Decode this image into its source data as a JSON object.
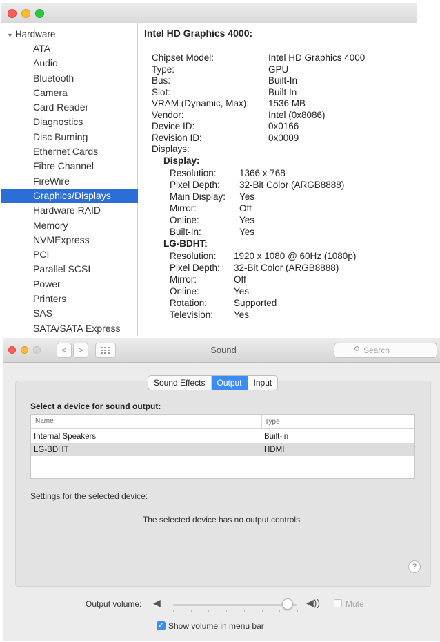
{
  "sysinfo": {
    "group": "Hardware",
    "items": [
      "ATA",
      "Audio",
      "Bluetooth",
      "Camera",
      "Card Reader",
      "Diagnostics",
      "Disc Burning",
      "Ethernet Cards",
      "Fibre Channel",
      "FireWire",
      "Graphics/Displays",
      "Hardware RAID",
      "Memory",
      "NVMExpress",
      "PCI",
      "Parallel SCSI",
      "Power",
      "Printers",
      "SAS",
      "SATA/SATA Express"
    ],
    "selected_item": "Graphics/Displays",
    "header": "Intel HD Graphics 4000:",
    "props": [
      {
        "k": "Chipset Model:",
        "v": "Intel HD Graphics 4000"
      },
      {
        "k": "Type:",
        "v": "GPU"
      },
      {
        "k": "Bus:",
        "v": "Built-In"
      },
      {
        "k": "Slot:",
        "v": "Built In"
      },
      {
        "k": "VRAM (Dynamic, Max):",
        "v": "1536 MB"
      },
      {
        "k": "Vendor:",
        "v": "Intel (0x8086)"
      },
      {
        "k": "Device ID:",
        "v": "0x0166"
      },
      {
        "k": "Revision ID:",
        "v": "0x0009"
      },
      {
        "k": "Displays:",
        "v": ""
      }
    ],
    "displays_heading": "Display:",
    "display1_props": [
      {
        "k": "Resolution:",
        "v": "1366 x 768"
      },
      {
        "k": "Pixel Depth:",
        "v": "32-Bit Color (ARGB8888)"
      },
      {
        "k": "Main Display:",
        "v": "Yes"
      },
      {
        "k": "Mirror:",
        "v": "Off"
      },
      {
        "k": "Online:",
        "v": "Yes"
      },
      {
        "k": "Built-In:",
        "v": "Yes"
      }
    ],
    "display2_name": "LG-BDHT:",
    "display2_props": [
      {
        "k": "Resolution:",
        "v": "1920 x 1080 @ 60Hz (1080p)"
      },
      {
        "k": "Pixel Depth:",
        "v": "32-Bit Color (ARGB8888)"
      },
      {
        "k": "Mirror:",
        "v": "Off"
      },
      {
        "k": "Online:",
        "v": "Yes"
      },
      {
        "k": "Rotation:",
        "v": "Supported"
      },
      {
        "k": "Television:",
        "v": "Yes"
      }
    ]
  },
  "sound": {
    "title": "Sound",
    "search_placeholder": "Search",
    "nav_back": "<",
    "nav_forward": ">",
    "grid_icon": "grid-icon",
    "tabs": [
      {
        "label": "Sound Effects",
        "active": false
      },
      {
        "label": "Output",
        "active": true
      },
      {
        "label": "Input",
        "active": false
      }
    ],
    "select_label": "Select a device for sound output:",
    "table": {
      "headers": [
        "Name",
        "Type"
      ],
      "rows": [
        {
          "name": "Internal Speakers",
          "type": "Built-in",
          "selected": false
        },
        {
          "name": "LG-BDHT",
          "type": "HDMI",
          "selected": true
        }
      ]
    },
    "settings_label": "Settings for the selected device:",
    "no_controls": "The selected device has no output controls",
    "help": "?",
    "output_volume_label": "Output volume:",
    "output_volume_level": 0.92,
    "mute_label": "Mute",
    "mute_checked": false,
    "show_volume_label": "Show volume in menu bar",
    "show_volume_checked": true
  },
  "colors": {
    "selection_blue": "#2c6ed6",
    "segment_active": "#3d8cf6"
  }
}
